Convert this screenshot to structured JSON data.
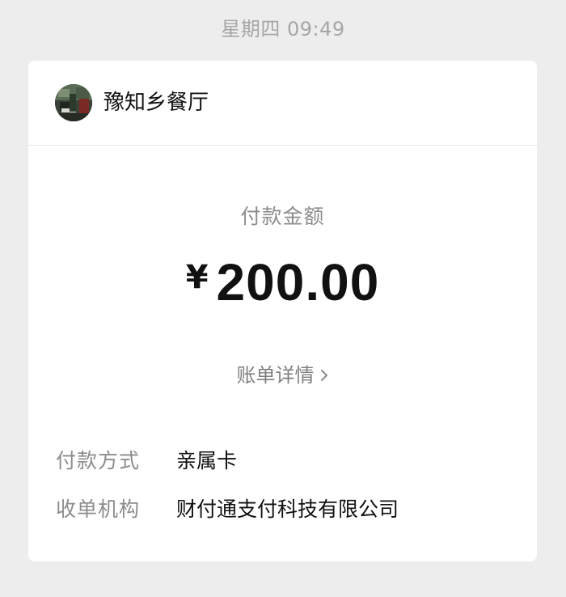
{
  "header": {
    "timestamp": "星期四 09:49"
  },
  "merchant": {
    "name": "豫知乡餐厅",
    "avatar_icon": "merchant-avatar-photo"
  },
  "payment": {
    "amount_label": "付款金额",
    "currency_symbol": "¥",
    "amount": "200.00",
    "details_link_label": "账单详情",
    "details_link_icon": "chevron-right-icon"
  },
  "info": {
    "rows": [
      {
        "label": "付款方式",
        "value": "亲属卡"
      },
      {
        "label": "收单机构",
        "value": "财付通支付科技有限公司"
      }
    ]
  },
  "colors": {
    "background": "#ededed",
    "card": "#ffffff",
    "muted_text": "#8c8c8c",
    "primary_text": "#111111"
  }
}
